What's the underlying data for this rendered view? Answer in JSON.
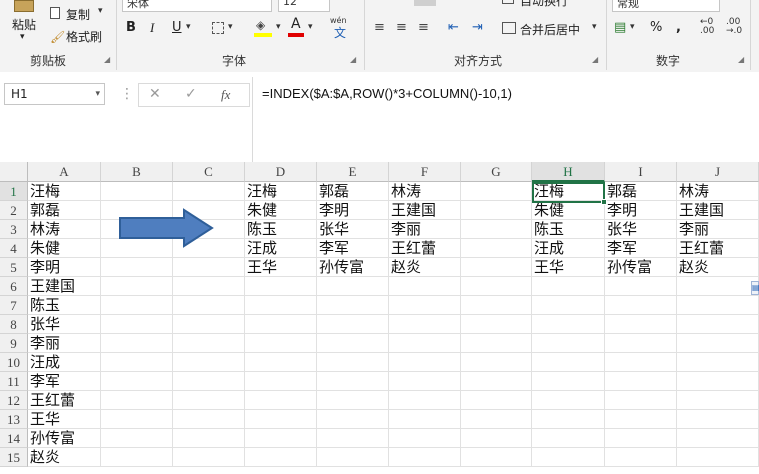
{
  "ribbon": {
    "clipboard": {
      "paste_label": "粘贴",
      "copy_label": "复制",
      "format_painter_label": "格式刷",
      "group_label": "剪贴板"
    },
    "font": {
      "font_name": "宋体",
      "font_size": "12",
      "bold": "B",
      "italic": "I",
      "underline": "U",
      "phonetic": "wén",
      "font_color_glyph": "A",
      "group_label": "字体"
    },
    "alignment": {
      "wrap_label": "自动换行",
      "merge_label": "合并后居中",
      "group_label": "对齐方式"
    },
    "number": {
      "format_value": "常规",
      "percent": "%",
      "comma": ",",
      "group_label": "数字"
    }
  },
  "formula_bar": {
    "name_box": "H1",
    "cancel": "✕",
    "enter": "✓",
    "fx": "fx",
    "formula": "=INDEX($A:$A,ROW()*3+COLUMN()-10,1)"
  },
  "sheet": {
    "columns": [
      "A",
      "B",
      "C",
      "D",
      "E",
      "F",
      "G",
      "H",
      "I",
      "J"
    ],
    "selected_column": "H",
    "rows": [
      "1",
      "2",
      "3",
      "4",
      "5",
      "6",
      "7",
      "8",
      "9",
      "10",
      "11",
      "12",
      "13",
      "14",
      "15"
    ],
    "selected_row": "1",
    "col_a": [
      "汪梅",
      "郭磊",
      "林涛",
      "朱健",
      "李明",
      "王建国",
      "陈玉",
      "张华",
      "李丽",
      "汪成",
      "李军",
      "王红蕾",
      "王华",
      "孙传富",
      "赵炎"
    ],
    "table_def": [
      [
        "汪梅",
        "郭磊",
        "林涛"
      ],
      [
        "朱健",
        "李明",
        "王建国"
      ],
      [
        "陈玉",
        "张华",
        "李丽"
      ],
      [
        "汪成",
        "李军",
        "王红蕾"
      ],
      [
        "王华",
        "孙传富",
        "赵炎"
      ]
    ],
    "table_hij": [
      [
        "汪梅",
        "郭磊",
        "林涛"
      ],
      [
        "朱健",
        "李明",
        "王建国"
      ],
      [
        "陈玉",
        "张华",
        "李丽"
      ],
      [
        "汪成",
        "李军",
        "王红蕾"
      ],
      [
        "王华",
        "孙传富",
        "赵炎"
      ]
    ],
    "arrow_color": "#4f7ebf",
    "accent_color": "#217346"
  }
}
